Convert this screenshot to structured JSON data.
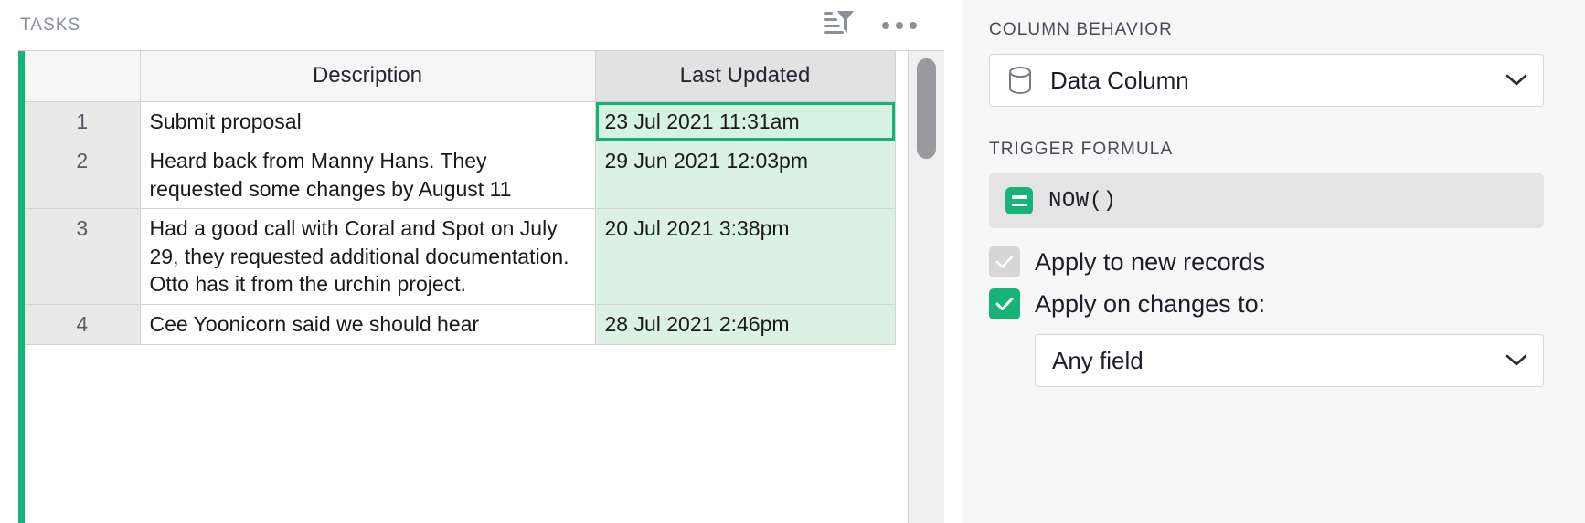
{
  "grid": {
    "section_title": "TASKS",
    "toolbar": {
      "filter_icon": "sort-filter-icon",
      "more_icon": "more-options-icon"
    },
    "columns": [
      {
        "key": "num",
        "label": ""
      },
      {
        "key": "desc",
        "label": "Description"
      },
      {
        "key": "upd",
        "label": "Last Updated"
      }
    ],
    "rows": [
      {
        "num": "1",
        "desc": "Submit proposal",
        "upd": "23 Jul 2021 11:31am",
        "active": true
      },
      {
        "num": "2",
        "desc": "Heard back from Manny Hans. They requested some changes by August 11",
        "upd": "29 Jun 2021 12:03pm",
        "active": false
      },
      {
        "num": "3",
        "desc": "Had a good call with Coral and Spot on July 29, they requested additional documentation. Otto has it from the urchin project.",
        "upd": "20 Jul 2021 3:38pm",
        "active": false
      },
      {
        "num": "4",
        "desc": "Cee Yoonicorn said we should hear",
        "upd": "28 Jul 2021 2:46pm",
        "active": false
      }
    ]
  },
  "panel": {
    "column_behavior_label": "COLUMN BEHAVIOR",
    "column_behavior_value": "Data Column",
    "column_behavior_icon": "database-icon",
    "trigger_formula_label": "TRIGGER FORMULA",
    "formula_value": "NOW()",
    "formula_icon": "formula-equals-icon",
    "apply_new_records_label": "Apply to new records",
    "apply_new_records_checked": true,
    "apply_new_records_disabled": true,
    "apply_on_changes_label": "Apply on changes to:",
    "apply_on_changes_checked": true,
    "any_field_value": "Any field"
  },
  "colors": {
    "accent_green": "#16b378",
    "cell_highlight": "#dcf1e5",
    "panel_bg": "#f7f7f7",
    "header_bg": "#f6f6f6",
    "active_header_bg": "#e2e2e2"
  }
}
